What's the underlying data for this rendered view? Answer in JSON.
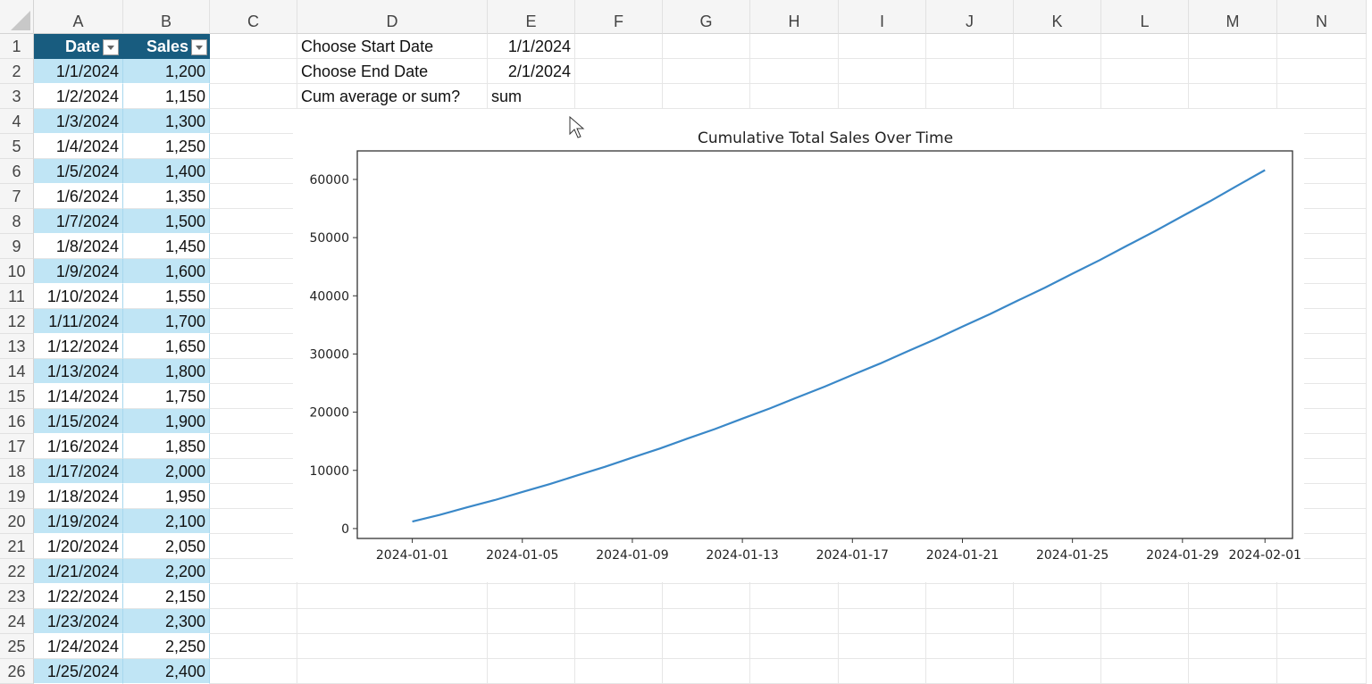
{
  "sheet": {
    "columns": [
      "A",
      "B",
      "C",
      "D",
      "E",
      "F",
      "G",
      "H",
      "I",
      "J",
      "K",
      "L",
      "M",
      "N"
    ],
    "rows": [
      1,
      2,
      3,
      4,
      5,
      6,
      7,
      8,
      9,
      10,
      11,
      12,
      13,
      14,
      15,
      16,
      17,
      18,
      19,
      20,
      21,
      22,
      23,
      24,
      25,
      26
    ],
    "table": {
      "headers": [
        "Date",
        "Sales"
      ],
      "rows": [
        [
          "1/1/2024",
          "1,200"
        ],
        [
          "1/2/2024",
          "1,150"
        ],
        [
          "1/3/2024",
          "1,300"
        ],
        [
          "1/4/2024",
          "1,250"
        ],
        [
          "1/5/2024",
          "1,400"
        ],
        [
          "1/6/2024",
          "1,350"
        ],
        [
          "1/7/2024",
          "1,500"
        ],
        [
          "1/8/2024",
          "1,450"
        ],
        [
          "1/9/2024",
          "1,600"
        ],
        [
          "1/10/2024",
          "1,550"
        ],
        [
          "1/11/2024",
          "1,700"
        ],
        [
          "1/12/2024",
          "1,650"
        ],
        [
          "1/13/2024",
          "1,800"
        ],
        [
          "1/14/2024",
          "1,750"
        ],
        [
          "1/15/2024",
          "1,900"
        ],
        [
          "1/16/2024",
          "1,850"
        ],
        [
          "1/17/2024",
          "2,000"
        ],
        [
          "1/18/2024",
          "1,950"
        ],
        [
          "1/19/2024",
          "2,100"
        ],
        [
          "1/20/2024",
          "2,050"
        ],
        [
          "1/21/2024",
          "2,200"
        ],
        [
          "1/22/2024",
          "2,150"
        ],
        [
          "1/23/2024",
          "2,300"
        ],
        [
          "1/24/2024",
          "2,250"
        ],
        [
          "1/25/2024",
          "2,400"
        ]
      ],
      "header_color": "#185c7f",
      "band_color": "#c0e5f5"
    },
    "controls": [
      {
        "label": "Choose Start Date",
        "value": "1/1/2024"
      },
      {
        "label": "Choose End Date",
        "value": "2/1/2024"
      },
      {
        "label": "Cum average or sum?",
        "value": "sum"
      }
    ]
  },
  "chart_data": {
    "type": "line",
    "title": "Cumulative Total Sales Over Time",
    "xlabel": "",
    "ylabel": "",
    "x": [
      "2024-01-01",
      "2024-01-02",
      "2024-01-03",
      "2024-01-04",
      "2024-01-05",
      "2024-01-06",
      "2024-01-07",
      "2024-01-08",
      "2024-01-09",
      "2024-01-10",
      "2024-01-11",
      "2024-01-12",
      "2024-01-13",
      "2024-01-14",
      "2024-01-15",
      "2024-01-16",
      "2024-01-17",
      "2024-01-18",
      "2024-01-19",
      "2024-01-20",
      "2024-01-21",
      "2024-01-22",
      "2024-01-23",
      "2024-01-24",
      "2024-01-25",
      "2024-01-26",
      "2024-01-27",
      "2024-01-28",
      "2024-01-29",
      "2024-01-30",
      "2024-01-31",
      "2024-02-01"
    ],
    "y": [
      1200,
      2350,
      3650,
      4900,
      6300,
      7650,
      9150,
      10600,
      12200,
      13750,
      15450,
      17100,
      18900,
      20650,
      22550,
      24400,
      26400,
      28350,
      30450,
      32500,
      34700,
      36850,
      39150,
      41400,
      43800,
      46150,
      48650,
      51100,
      53700,
      56250,
      58950,
      61600
    ],
    "xticks": [
      "2024-01-01",
      "2024-01-05",
      "2024-01-09",
      "2024-01-13",
      "2024-01-17",
      "2024-01-21",
      "2024-01-25",
      "2024-01-29",
      "2024-02-01"
    ],
    "yticks": [
      0,
      10000,
      20000,
      30000,
      40000,
      50000,
      60000
    ],
    "ylim": [
      -1700,
      64900
    ],
    "xlim": [
      "2023-12-30",
      "2024-02-02"
    ],
    "grid": false,
    "line_color": "#3a88c8"
  }
}
